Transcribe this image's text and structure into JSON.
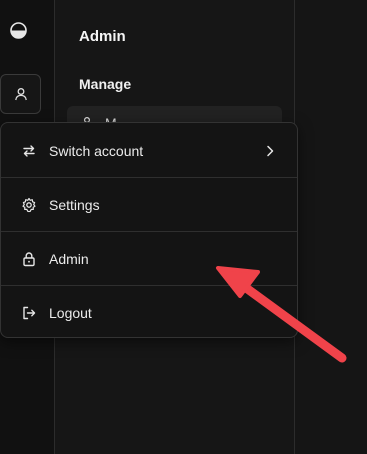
{
  "sidebar": {
    "logo_icon": "half-circle-logo-icon",
    "user_icon": "user-icon"
  },
  "panel": {
    "title": "Admin",
    "section_label": "Manage",
    "partial_item_label": "M..."
  },
  "menu": {
    "items": [
      {
        "label": "Switch account",
        "icon": "switch-arrows-icon",
        "has_submenu": true
      },
      {
        "label": "Settings",
        "icon": "gear-icon",
        "has_submenu": false
      },
      {
        "label": "Admin",
        "icon": "lock-icon",
        "has_submenu": false
      },
      {
        "label": "Logout",
        "icon": "logout-icon",
        "has_submenu": false
      }
    ]
  },
  "annotation": {
    "arrow_color": "#f0434a"
  },
  "colors": {
    "background": "#151515",
    "menu_background": "#141414",
    "border": "#333333",
    "text": "#ececec"
  }
}
